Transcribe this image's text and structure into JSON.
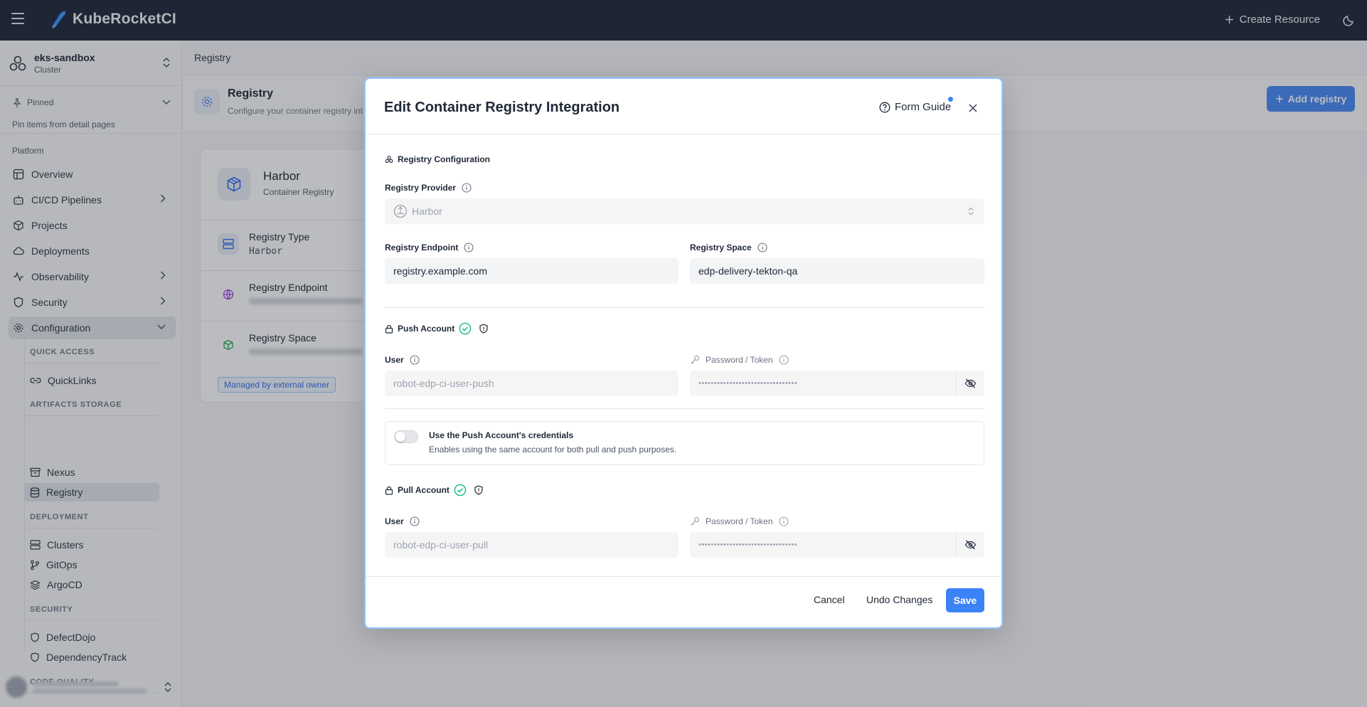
{
  "app": {
    "name": "KubeRocketCI",
    "create_resource": "Create Resource"
  },
  "cluster": {
    "name": "eks-sandbox",
    "type": "Cluster"
  },
  "sidebar": {
    "pinned_label": "Pinned",
    "pinned_hint": "Pin items from detail pages",
    "section": "Platform",
    "items": [
      {
        "label": "Overview",
        "icon": "layout-icon"
      },
      {
        "label": "CI/CD Pipelines",
        "icon": "bot-icon"
      },
      {
        "label": "Projects",
        "icon": "cube-icon"
      },
      {
        "label": "Deployments",
        "icon": "cloud-icon"
      },
      {
        "label": "Observability",
        "icon": "activity-icon"
      },
      {
        "label": "Security",
        "icon": "shield-icon"
      },
      {
        "label": "Configuration",
        "icon": "gear-icon"
      }
    ],
    "groups": {
      "quick_access": "QUICK ACCESS",
      "quicklinks": "QuickLinks",
      "artifacts_storage": "ARTIFACTS STORAGE",
      "nexus": "Nexus",
      "registry": "Registry",
      "deployment": "DEPLOYMENT",
      "clusters": "Clusters",
      "gitops": "GitOps",
      "argocd": "ArgoCD",
      "security": "SECURITY",
      "defectdojo": "DefectDojo",
      "dependencytrack": "DependencyTrack",
      "code_quality": "CODE QUALITY"
    }
  },
  "page": {
    "breadcrumb": "Registry",
    "title": "Registry",
    "subtitle": "Configure your container registry int",
    "add_button": "Add registry"
  },
  "card": {
    "title": "Harbor",
    "subtitle": "Container Registry",
    "rows": [
      {
        "label": "Registry Type",
        "value": "Harbor"
      },
      {
        "label": "Registry Endpoint"
      },
      {
        "label": "Registry Space"
      }
    ],
    "badge": "Managed by external owner"
  },
  "modal": {
    "title": "Edit Container Registry Integration",
    "form_guide": "Form Guide",
    "section_registry": "Registry Configuration",
    "provider_label": "Registry Provider",
    "provider_value": "Harbor",
    "endpoint_label": "Registry Endpoint",
    "endpoint_value": "registry.example.com",
    "space_label": "Registry Space",
    "space_value": "edp-delivery-tekton-qa",
    "push_account": "Push Account",
    "pull_account": "Pull Account",
    "user_label": "User",
    "password_label": "Password / Token",
    "push_user": "robot-edp-ci-user-push",
    "push_password": "••••••••••••••••••••••••••••••••",
    "pull_user": "robot-edp-ci-user-pull",
    "pull_password": "••••••••••••••••••••••••••••••••",
    "toggle_title": "Use the Push Account's credentials",
    "toggle_desc": "Enables using the same account for both pull and push purposes.",
    "toggle_on": false,
    "cancel": "Cancel",
    "undo": "Undo Changes",
    "save": "Save"
  },
  "colors": {
    "topbar": "#0e1a2b",
    "accent": "#3b82f6",
    "success": "#10b981"
  }
}
